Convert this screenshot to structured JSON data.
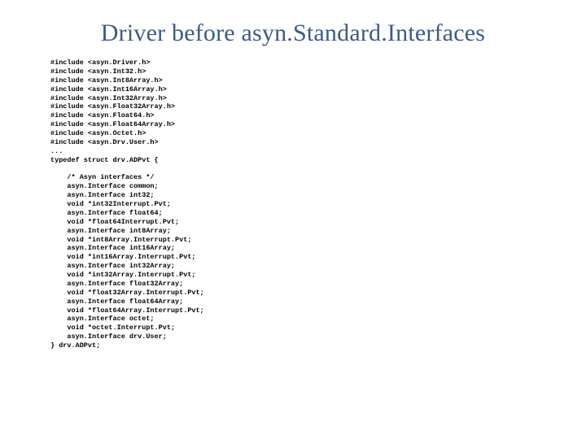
{
  "title": "Driver before asyn.Standard.Interfaces",
  "code": "#include <asyn.Driver.h>\n#include <asyn.Int32.h>\n#include <asyn.Int8Array.h>\n#include <asyn.Int16Array.h>\n#include <asyn.Int32Array.h>\n#include <asyn.Float32Array.h>\n#include <asyn.Float64.h>\n#include <asyn.Float64Array.h>\n#include <asyn.Octet.h>\n#include <asyn.Drv.User.h>\n...\ntypedef struct drv.ADPvt {\n\n    /* Asyn interfaces */\n    asyn.Interface common;\n    asyn.Interface int32;\n    void *int32Interrupt.Pvt;\n    asyn.Interface float64;\n    void *float64Interrupt.Pvt;\n    asyn.Interface int8Array;\n    void *int8Array.Interrupt.Pvt;\n    asyn.Interface int16Array;\n    void *int16Array.Interrupt.Pvt;\n    asyn.Interface int32Array;\n    void *int32Array.Interrupt.Pvt;\n    asyn.Interface float32Array;\n    void *float32Array.Interrupt.Pvt;\n    asyn.Interface float64Array;\n    void *float64Array.Interrupt.Pvt;\n    asyn.Interface octet;\n    void *octet.Interrupt.Pvt;\n    asyn.Interface drv.User;\n} drv.ADPvt;"
}
